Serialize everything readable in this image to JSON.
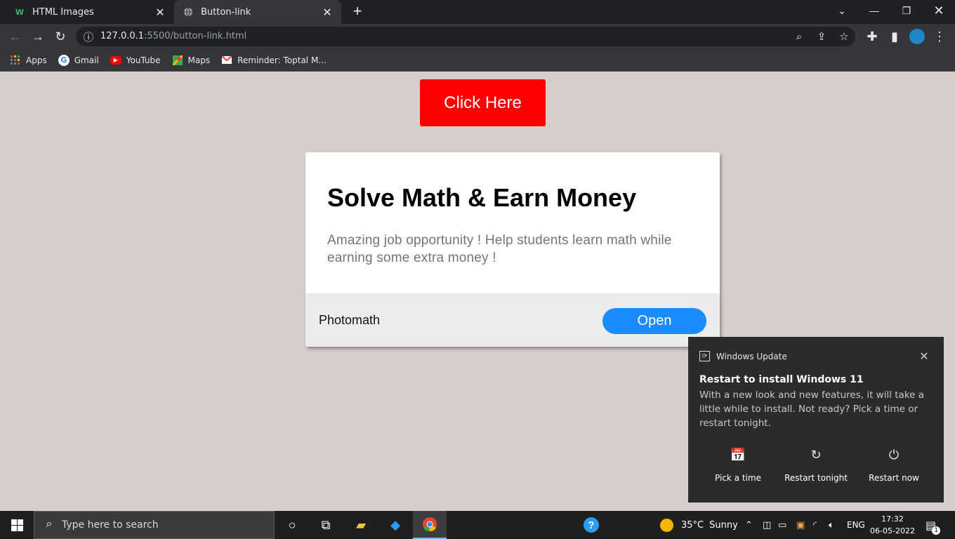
{
  "browser": {
    "tabs": [
      {
        "title": "HTML Images",
        "favicon": "w-icon"
      },
      {
        "title": "Button-link",
        "favicon": "globe-icon"
      }
    ],
    "address": {
      "host": "127.0.0.1",
      "path": ":5500/button-link.html"
    },
    "bookmarks": [
      {
        "label": "Apps",
        "icon": "apps-grid-icon"
      },
      {
        "label": "Gmail",
        "icon": "google-icon"
      },
      {
        "label": "YouTube",
        "icon": "youtube-icon"
      },
      {
        "label": "Maps",
        "icon": "maps-icon"
      },
      {
        "label": "Reminder: Toptal M...",
        "icon": "gmail-icon"
      }
    ]
  },
  "page": {
    "button_label": "Click Here",
    "button_color": "#fe0000",
    "card": {
      "title": "Solve Math & Earn Money",
      "text": "Amazing job opportunity ! Help students learn math while earning some extra money !",
      "brand": "Photomath",
      "open_label": "Open",
      "open_color": "#1a8cff"
    }
  },
  "notification": {
    "app": "Windows Update",
    "title": "Restart to install Windows 11",
    "body": "With a new look and new features, it will take a little while to install. Not ready? Pick a time or restart tonight.",
    "actions": [
      {
        "label": "Pick a time",
        "icon": "calendar-clock-icon"
      },
      {
        "label": "Restart tonight",
        "icon": "restart-icon"
      },
      {
        "label": "Restart now",
        "icon": "power-icon"
      }
    ]
  },
  "taskbar": {
    "search_placeholder": "Type here to search",
    "weather_temp": "35°C",
    "weather_desc": "Sunny",
    "language": "ENG",
    "time": "17:32",
    "date": "06-05-2022",
    "notification_count": "1"
  }
}
